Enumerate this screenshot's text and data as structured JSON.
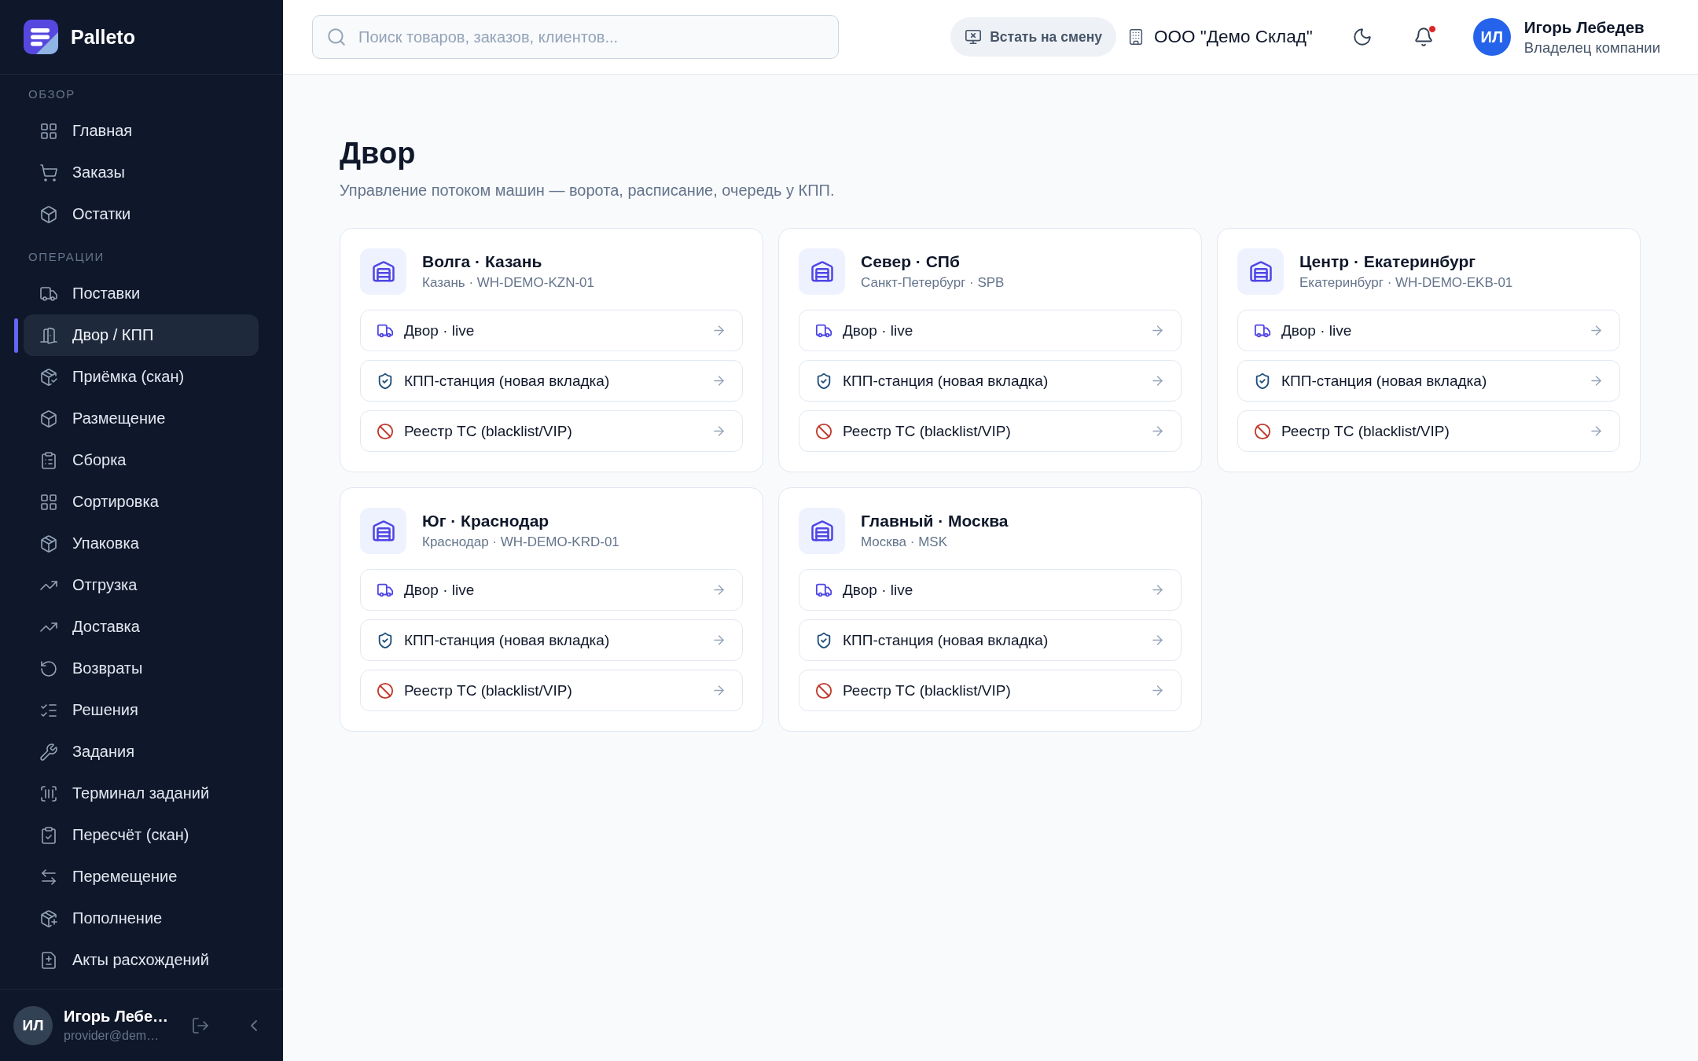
{
  "sidebar": {
    "brand": {
      "name": "Palleto"
    },
    "sections": [
      {
        "title": "ОБЗОР",
        "items": [
          {
            "label": "Главная",
            "selected": false
          },
          {
            "label": "Заказы",
            "selected": false
          },
          {
            "label": "Остатки",
            "selected": false
          }
        ]
      },
      {
        "title": "ОПЕРАЦИИ",
        "items": [
          {
            "label": "Поставки",
            "selected": false
          },
          {
            "label": "Двор / КПП",
            "selected": true
          },
          {
            "label": "Приёмка (скан)",
            "selected": false
          },
          {
            "label": "Размещение",
            "selected": false
          },
          {
            "label": "Сборка",
            "selected": false
          },
          {
            "label": "Сортировка",
            "selected": false
          },
          {
            "label": "Упаковка",
            "selected": false
          },
          {
            "label": "Отгрузка",
            "selected": false
          },
          {
            "label": "Доставка",
            "selected": false
          },
          {
            "label": "Возвраты",
            "selected": false
          },
          {
            "label": "Решения",
            "selected": false
          },
          {
            "label": "Задания",
            "selected": false
          },
          {
            "label": "Терминал заданий",
            "selected": false
          },
          {
            "label": "Пересчёт (скан)",
            "selected": false
          },
          {
            "label": "Перемещение",
            "selected": false
          },
          {
            "label": "Пополнение",
            "selected": false
          },
          {
            "label": "Акты расхождений",
            "selected": false
          }
        ]
      }
    ],
    "user": {
      "initials": "ИЛ",
      "name": "Игорь Лебе…",
      "email": "provider@dem…"
    }
  },
  "topbar": {
    "search": {
      "placeholder": "Поиск товаров, заказов, клиентов..."
    },
    "shift_button": "Встать на смену",
    "organization": "ООО \"Демо Склад\"",
    "notifications": {
      "unread": true
    },
    "user": {
      "initials": "ИЛ",
      "name": "Игорь Лебедев",
      "role": "Владелец компании"
    }
  },
  "page": {
    "title": "Двор",
    "subtitle": "Управление потоком машин — ворота, расписание, очередь у КПП."
  },
  "warehouses": [
    {
      "name": "Волга · Казань",
      "details": "Казань · WH-DEMO-KZN-01",
      "links": [
        {
          "kind": "yard",
          "label": "Двор · live"
        },
        {
          "kind": "checkpoint",
          "label": "КПП-станция (новая вкладка)"
        },
        {
          "kind": "registry",
          "label": "Реестр ТС (blacklist/VIP)"
        }
      ]
    },
    {
      "name": "Север · СПб",
      "details": "Санкт-Петербург · SPB",
      "links": [
        {
          "kind": "yard",
          "label": "Двор · live"
        },
        {
          "kind": "checkpoint",
          "label": "КПП-станция (новая вкладка)"
        },
        {
          "kind": "registry",
          "label": "Реестр ТС (blacklist/VIP)"
        }
      ]
    },
    {
      "name": "Центр · Екатеринбург",
      "details": "Екатеринбург · WH-DEMO-EKB-01",
      "links": [
        {
          "kind": "yard",
          "label": "Двор · live"
        },
        {
          "kind": "checkpoint",
          "label": "КПП-станция (новая вкладка)"
        },
        {
          "kind": "registry",
          "label": "Реестр ТС (blacklist/VIP)"
        }
      ]
    },
    {
      "name": "Юг · Краснодар",
      "details": "Краснодар · WH-DEMO-KRD-01",
      "links": [
        {
          "kind": "yard",
          "label": "Двор · live"
        },
        {
          "kind": "checkpoint",
          "label": "КПП-станция (новая вкладка)"
        },
        {
          "kind": "registry",
          "label": "Реестр ТС (blacklist/VIP)"
        }
      ]
    },
    {
      "name": "Главный · Москва",
      "details": "Москва · MSK",
      "links": [
        {
          "kind": "yard",
          "label": "Двор · live"
        },
        {
          "kind": "checkpoint",
          "label": "КПП-станция (новая вкладка)"
        },
        {
          "kind": "registry",
          "label": "Реестр ТС (blacklist/VIP)"
        }
      ]
    }
  ]
}
